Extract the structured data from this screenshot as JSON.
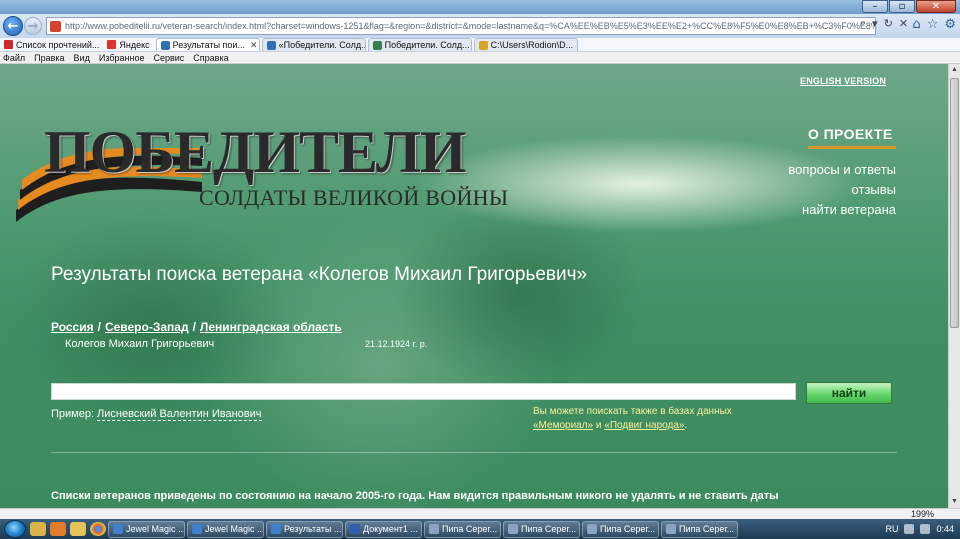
{
  "browser": {
    "url": "http://www.pobeditelii.ru/veteran-search/index.html?charset=windows-1251&flag=&region=&district=&mode=lastname&q=%CA%EE%EB%E5%E3%EE%E2+%CC%E8%F5%E0%E8%EB+%C3%F0%E8%E3%EE%F0%FC%E5%E2%E8%F7",
    "favorites": [
      {
        "label": "Список прочтений...",
        "color": "#cc2b2b"
      },
      {
        "label": "Яндекс",
        "color": "#e0342a"
      }
    ],
    "tabs": [
      {
        "label": "Результаты пои...",
        "active": true,
        "color": "#2f6fb7"
      },
      {
        "label": "«Победители. Солд...",
        "active": false,
        "color": "#2f6fb7"
      },
      {
        "label": "Победители. Солд...",
        "active": false,
        "color": "#3a7c4a"
      },
      {
        "label": "C:\\Users\\Rodion\\D...",
        "active": false,
        "color": "#d7a526"
      }
    ],
    "menu": [
      "Файл",
      "Правка",
      "Вид",
      "Избранное",
      "Сервис",
      "Справка"
    ],
    "zoom": "199%"
  },
  "page": {
    "english": "ENGLISH VERSION",
    "logo_main": "ПОБЕДИТЕЛИ",
    "logo_sub": "СОЛДАТЫ ВЕЛИКОЙ ВОЙНЫ",
    "about": "О ПРОЕКТЕ",
    "nav": {
      "faq": "вопросы и ответы",
      "reviews": "отзывы",
      "find": "найти ветерана"
    },
    "heading": "Результаты поиска ветерана «Колегов Михаил Григорьевич»",
    "crumbs": [
      "Россия",
      "Северо-Запад",
      "Ленинградская область"
    ],
    "crumb_sep": "/",
    "result": {
      "name": "Колегов Михаил Григорьевич",
      "date": "21.12.1924 г. р."
    },
    "search": {
      "value": "",
      "button": "найти"
    },
    "example_label": "Пример:",
    "example_name": "Лисневский Валентин Иванович",
    "also_text": "Вы можете поискать также в базах данных",
    "also_link1": "«Мемориал»",
    "also_and": " и ",
    "also_link2": "«Подвиг народа»",
    "also_end": ".",
    "footnote": "Списки ветеранов приведены по состоянию на начало 2005-го года. Нам видится правильным никого не удалять и не ставить даты"
  },
  "taskbar": {
    "tasks": [
      {
        "label": "Jewel Magic ...",
        "color": "#3f7fd0"
      },
      {
        "label": "Jewel Magic ...",
        "color": "#3f7fd0"
      },
      {
        "label": "Результаты ...",
        "color": "#3f7fd0"
      },
      {
        "label": "Документ1 ...",
        "color": "#2f5fae"
      },
      {
        "label": "Пипа Серег...",
        "color": "#8aa4c2"
      },
      {
        "label": "Пипа Серег...",
        "color": "#8aa4c2"
      },
      {
        "label": "Пипа Серег...",
        "color": "#8aa4c2"
      },
      {
        "label": "Пипа Серег...",
        "color": "#8aa4c2"
      }
    ],
    "lang": "RU",
    "clock": "0:44"
  },
  "colors": {
    "accent": "#d9982a",
    "link_yellow": "#ffef9a",
    "button_green": "#5fd567"
  }
}
